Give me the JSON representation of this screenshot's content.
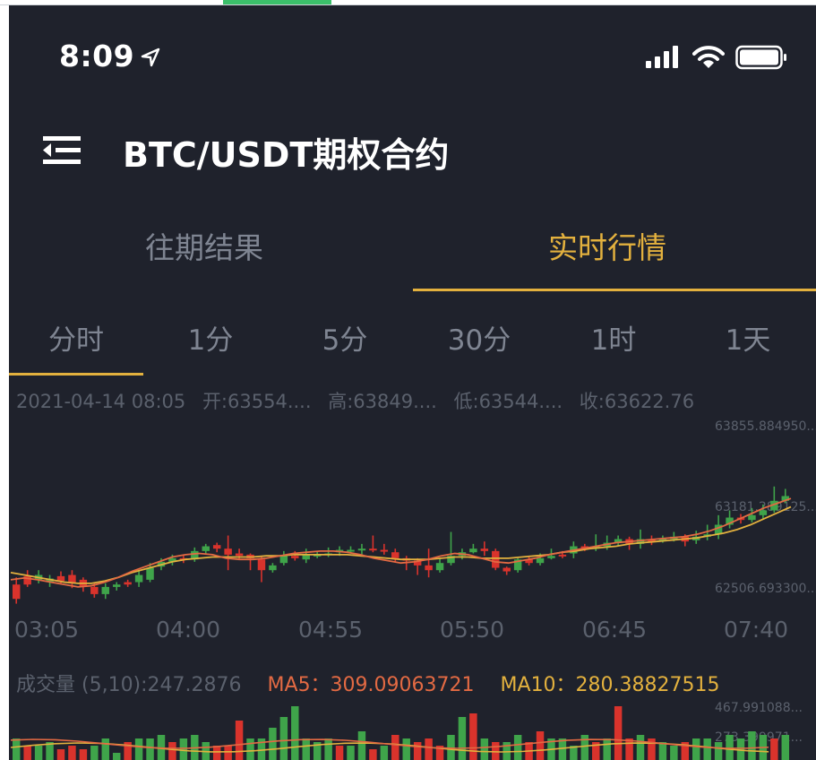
{
  "status": {
    "time": "8:09"
  },
  "header": {
    "title": "BTC/USDT期权合约"
  },
  "tabs": [
    {
      "label": "往期结果"
    },
    {
      "label": "实时行情"
    }
  ],
  "periods": [
    "分时",
    "1分",
    "5分",
    "30分",
    "1时",
    "1天"
  ],
  "info": {
    "datetime": "2021-04-14 08:05",
    "open": "开:63554....",
    "high": "高:63849....",
    "low": "低:63544....",
    "close": "收:63622.76"
  },
  "yaxis": [
    "63855.884950...",
    "63181.289125...",
    "62506.693300..."
  ],
  "time_labels": [
    "03:05",
    "04:00",
    "04:55",
    "05:50",
    "06:45",
    "07:40"
  ],
  "volume": {
    "label": "成交量 (5,10):247.2876",
    "ma5": "MA5：309.09063721",
    "ma10": "MA10：280.38827515",
    "yaxis": [
      "467.991088...",
      "273.399971..."
    ]
  },
  "colors": {
    "up": "#3fa44a",
    "down": "#d9332c",
    "ma5": "#e36a43",
    "ma10": "#e3b13e",
    "accent": "#e3b13e"
  },
  "chart_data": {
    "type": "candlestick",
    "ylim": [
      62506.6933,
      63855.88495
    ],
    "candles": [
      [
        62580,
        62460,
        62640,
        62420
      ],
      [
        62650,
        62580,
        62700,
        62560
      ],
      [
        62620,
        62660,
        62700,
        62590
      ],
      [
        62600,
        62630,
        62660,
        62560
      ],
      [
        62650,
        62610,
        62690,
        62580
      ],
      [
        62660,
        62590,
        62700,
        62550
      ],
      [
        62620,
        62560,
        62640,
        62520
      ],
      [
        62560,
        62500,
        62600,
        62470
      ],
      [
        62500,
        62560,
        62590,
        62460
      ],
      [
        62560,
        62580,
        62600,
        62530
      ],
      [
        62600,
        62580,
        62620,
        62560
      ],
      [
        62600,
        62660,
        62700,
        62560
      ],
      [
        62620,
        62720,
        62760,
        62600
      ],
      [
        62730,
        62770,
        62800,
        62700
      ],
      [
        62770,
        62800,
        62830,
        62740
      ],
      [
        62800,
        62790,
        62830,
        62760
      ],
      [
        62790,
        62860,
        62890,
        62770
      ],
      [
        62860,
        62900,
        62920,
        62830
      ],
      [
        62910,
        62880,
        62930,
        62850
      ],
      [
        62880,
        62830,
        62990,
        62700
      ],
      [
        62840,
        62820,
        62880,
        62790
      ],
      [
        62830,
        62800,
        62840,
        62700
      ],
      [
        62790,
        62700,
        62820,
        62600
      ],
      [
        62700,
        62740,
        62760,
        62680
      ],
      [
        62760,
        62820,
        62860,
        62740
      ],
      [
        62820,
        62800,
        62860,
        62780
      ],
      [
        62790,
        62830,
        62880,
        62760
      ],
      [
        62830,
        62830,
        62860,
        62800
      ],
      [
        62830,
        62840,
        62890,
        62810
      ],
      [
        62850,
        62870,
        62900,
        62820
      ],
      [
        62870,
        62870,
        62900,
        62840
      ],
      [
        62880,
        62880,
        62920,
        62830
      ],
      [
        62880,
        62870,
        62990,
        62850
      ],
      [
        62870,
        62860,
        62920,
        62830
      ],
      [
        62850,
        62800,
        62880,
        62770
      ],
      [
        62800,
        62780,
        62820,
        62700
      ],
      [
        62780,
        62740,
        62800,
        62660
      ],
      [
        62740,
        62700,
        62880,
        62640
      ],
      [
        62700,
        62760,
        62800,
        62680
      ],
      [
        62760,
        62820,
        63020,
        62740
      ],
      [
        62820,
        62850,
        62880,
        62790
      ],
      [
        62850,
        62880,
        62920,
        62840
      ],
      [
        62880,
        62860,
        62940,
        62820
      ],
      [
        62860,
        62720,
        62880,
        62700
      ],
      [
        62720,
        62690,
        62730,
        62660
      ],
      [
        62700,
        62790,
        62800,
        62680
      ],
      [
        62790,
        62760,
        62820,
        62740
      ],
      [
        62760,
        62800,
        62840,
        62740
      ],
      [
        62800,
        62820,
        62880,
        62790
      ],
      [
        62830,
        62820,
        62860,
        62800
      ],
      [
        62840,
        62900,
        62940,
        62800
      ],
      [
        62900,
        62880,
        62920,
        62860
      ],
      [
        62880,
        62900,
        63000,
        62860
      ],
      [
        62900,
        62930,
        62990,
        62870
      ],
      [
        62930,
        62960,
        62990,
        62900
      ],
      [
        62960,
        62920,
        62980,
        62870
      ],
      [
        62920,
        62960,
        63040,
        62880
      ],
      [
        62960,
        62940,
        62990,
        62910
      ],
      [
        62950,
        62960,
        62990,
        62930
      ],
      [
        62960,
        62980,
        63020,
        62940
      ],
      [
        62980,
        62940,
        63000,
        62900
      ],
      [
        62950,
        62980,
        63030,
        62920
      ],
      [
        62980,
        63000,
        63080,
        62950
      ],
      [
        63000,
        63080,
        63160,
        62960
      ],
      [
        63080,
        63140,
        63200,
        63050
      ],
      [
        63140,
        63120,
        63170,
        63090
      ],
      [
        63120,
        63160,
        63220,
        63100
      ],
      [
        63160,
        63200,
        63250,
        63130
      ],
      [
        63200,
        63280,
        63400,
        63180
      ],
      [
        63280,
        63320,
        63380,
        63260
      ]
    ],
    "ma5": [
      62620,
      62635,
      62620,
      62600,
      62580,
      62560,
      62570,
      62600,
      62640,
      62690,
      62730,
      62770,
      62810,
      62830,
      62840,
      62830,
      62800,
      62790,
      62790,
      62800,
      62820,
      62840,
      62850,
      62860,
      62860,
      62850,
      62830,
      62800,
      62780,
      62760,
      62770,
      62790,
      62820,
      62840,
      62830,
      62800,
      62770,
      62760,
      62780,
      62800,
      62830,
      62850,
      62870,
      62890,
      62910,
      62930,
      62940,
      62950,
      62960,
      62970,
      62980,
      63000,
      63030,
      63070,
      63120,
      63170,
      63220,
      63260,
      63300
    ],
    "ma10": [
      62680,
      62660,
      62640,
      62620,
      62600,
      62590,
      62590,
      62610,
      62640,
      62680,
      62710,
      62740,
      62770,
      62790,
      62800,
      62810,
      62810,
      62810,
      62810,
      62820,
      62820,
      62830,
      62830,
      62830,
      62830,
      62830,
      62820,
      62810,
      62800,
      62790,
      62790,
      62790,
      62800,
      62810,
      62810,
      62800,
      62800,
      62800,
      62810,
      62820,
      62830,
      62850,
      62860,
      62880,
      62890,
      62900,
      62920,
      62930,
      62940,
      62950,
      62960,
      62970,
      62990,
      63010,
      63040,
      63080,
      63130,
      63180,
      63230
    ],
    "volumes": [
      [
        0.3,
        1
      ],
      [
        0.2,
        0
      ],
      [
        0.2,
        1
      ],
      [
        0.25,
        1
      ],
      [
        0.15,
        0
      ],
      [
        0.2,
        0
      ],
      [
        0.15,
        0
      ],
      [
        0.2,
        1
      ],
      [
        0.3,
        1
      ],
      [
        0.1,
        1
      ],
      [
        0.25,
        0
      ],
      [
        0.3,
        1
      ],
      [
        0.3,
        1
      ],
      [
        0.35,
        1
      ],
      [
        0.25,
        0
      ],
      [
        0.3,
        1
      ],
      [
        0.35,
        1
      ],
      [
        0.25,
        1
      ],
      [
        0.2,
        0
      ],
      [
        0.2,
        0
      ],
      [
        0.55,
        0
      ],
      [
        0.3,
        1
      ],
      [
        0.3,
        1
      ],
      [
        0.45,
        1
      ],
      [
        0.6,
        1
      ],
      [
        0.75,
        1
      ],
      [
        0.3,
        1
      ],
      [
        0.25,
        1
      ],
      [
        0.3,
        1
      ],
      [
        0.2,
        0
      ],
      [
        0.2,
        1
      ],
      [
        0.4,
        1
      ],
      [
        0.15,
        0
      ],
      [
        0.2,
        1
      ],
      [
        0.35,
        0
      ],
      [
        0.3,
        1
      ],
      [
        0.25,
        0
      ],
      [
        0.3,
        0
      ],
      [
        0.2,
        0
      ],
      [
        0.35,
        1
      ],
      [
        0.6,
        1
      ],
      [
        0.65,
        0
      ],
      [
        0.3,
        1
      ],
      [
        0.25,
        0
      ],
      [
        0.25,
        1
      ],
      [
        0.35,
        1
      ],
      [
        0.25,
        0
      ],
      [
        0.4,
        0
      ],
      [
        0.3,
        1
      ],
      [
        0.3,
        1
      ],
      [
        0.2,
        1
      ],
      [
        0.35,
        1
      ],
      [
        0.25,
        0
      ],
      [
        0.3,
        1
      ],
      [
        0.75,
        0
      ],
      [
        0.3,
        0
      ],
      [
        0.35,
        1
      ],
      [
        0.3,
        0
      ],
      [
        0.25,
        1
      ],
      [
        0.2,
        1
      ],
      [
        0.25,
        0
      ],
      [
        0.3,
        1
      ],
      [
        0.3,
        1
      ],
      [
        0.25,
        1
      ],
      [
        0.35,
        1
      ],
      [
        0.3,
        1
      ],
      [
        0.4,
        1
      ],
      [
        0.35,
        1
      ],
      [
        0.3,
        0
      ],
      [
        0.35,
        1
      ]
    ]
  }
}
